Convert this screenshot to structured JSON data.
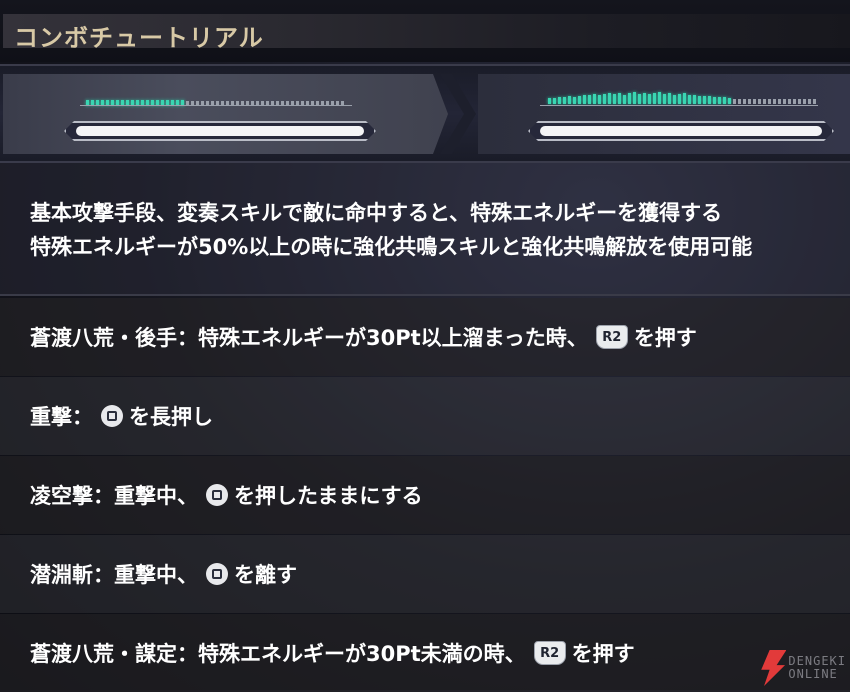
{
  "header": {
    "title": "コンボチュートリアル"
  },
  "demo": {
    "left_meter": {
      "fill_fraction": 0.38
    },
    "right_meter": {
      "fill_fraction": 0.68
    },
    "left_hp": {
      "fill_fraction": 1.0
    },
    "right_hp": {
      "fill_fraction": 1.0
    }
  },
  "description": {
    "line1": "基本攻撃手段、変奏スキルで敵に命中すると、特殊エネルギーを獲得する",
    "line2": "特殊エネルギーが50%以上の時に強化共鳴スキルと強化共鳴解放を使用可能"
  },
  "moves": [
    {
      "before": "蒼渡八荒・後手：特殊エネルギーが30Pt以上溜まった時、",
      "button": "R2",
      "button_icon": "r2-button-icon",
      "after": "を押す"
    },
    {
      "before": "重撃：",
      "button": "",
      "button_icon": "square-button-icon",
      "after": "を長押し"
    },
    {
      "before": "凌空撃：重撃中、",
      "button": "",
      "button_icon": "square-button-icon",
      "after": "を押したままにする"
    },
    {
      "before": "潜淵斬：重撃中、",
      "button": "",
      "button_icon": "square-button-icon",
      "after": "を離す"
    },
    {
      "before": "蒼渡八荒・謀定：特殊エネルギーが30Pt未満の時、",
      "button": "R2",
      "button_icon": "r2-button-icon",
      "after": "を押す"
    }
  ],
  "watermark": {
    "line1": "DENGEKI",
    "line2": "ONLINE",
    "accent": "#e23a3a"
  },
  "colors": {
    "meter_on": "#3ad6b2",
    "title": "#d8c9a6"
  }
}
